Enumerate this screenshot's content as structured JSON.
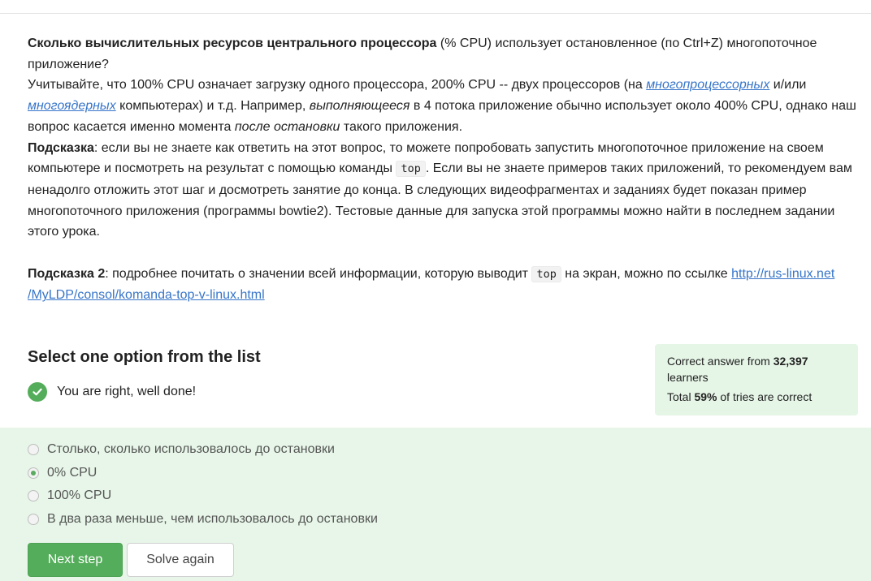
{
  "question": {
    "p1_bold": "Сколько вычислительных ресурсов центрального процессора",
    "p1_rest": " (% CPU) использует остановленное (по Ctrl+Z) многопоточное приложение?",
    "p2_a": "Учитывайте, что 100% CPU означает загрузку одного процессора, 200% CPU -- двух процессоров (на ",
    "p2_link1": "многопроцессорных",
    "p2_b": " и/или ",
    "p2_link2": "многоядерных",
    "p2_c": " компьютерах) и т.д. Например, ",
    "p2_em1": "выполняющееся",
    "p2_d": " в 4 потока приложение обычно использует около 400% CPU, однако наш вопрос касается именно момента ",
    "p2_em2": "после остановки",
    "p2_e": " такого приложения.",
    "hint1_label": "Подсказка",
    "hint1_a": ": если вы не знаете как ответить на этот вопрос, то можете попробовать запустить многопоточное приложение на своем компьютере и посмотреть на результат с помощью команды ",
    "hint1_code": "top",
    "hint1_b": ". Если вы не знаете примеров таких приложений, то рекомендуем вам ненадолго отложить этот шаг и досмотреть занятие до конца. В следующих видеофрагментах и заданиях будет показан пример многопоточного приложения (программы bowtie2). Тестовые данные для запуска этой программы можно найти в последнем задании этого урока.",
    "hint2_label": "Подсказка 2",
    "hint2_a": ": подробнее почитать о значении всей информации, которую выводит ",
    "hint2_code": "top",
    "hint2_b": " на экран, можно по ссылке ",
    "hint2_link_line1": "http://rus-linux.net",
    "hint2_link_line2": "/MyLDP/consol/komanda-top-v-linux.html"
  },
  "quiz": {
    "heading": "Select one option from the list",
    "feedback": "You are right, well done!",
    "options": [
      {
        "label": "Столько, сколько использовалось до остановки",
        "selected": false
      },
      {
        "label": "0% CPU",
        "selected": true
      },
      {
        "label": "100% CPU",
        "selected": false
      },
      {
        "label": "В два раза меньше, чем использовалось до остановки",
        "selected": false
      }
    ],
    "next_label": "Next step",
    "again_label": "Solve again"
  },
  "stats": {
    "line1_a": "Correct answer from ",
    "learners_count": "32,397",
    "line1_b": " learners",
    "line2_a": "Total ",
    "percent": "59%",
    "line2_b": " of tries are correct"
  },
  "colors": {
    "accent": "#54ad5a",
    "answers_bg": "#e7f6e8",
    "stats_bg": "#e5f5e6",
    "link": "#3775c9"
  },
  "icons": {
    "feedback_icon": "check-circle-icon"
  }
}
